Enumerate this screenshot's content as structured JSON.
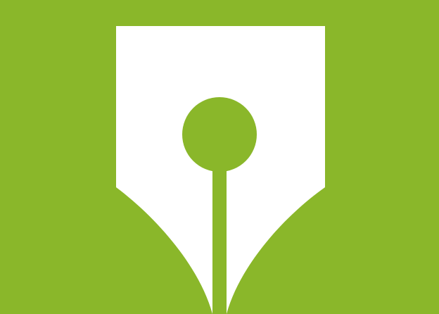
{
  "icon": "fountain-pen-nib-icon",
  "colors": {
    "background": "#8ab72a",
    "nib": "#ffffff",
    "accent": "#8ab72a"
  }
}
